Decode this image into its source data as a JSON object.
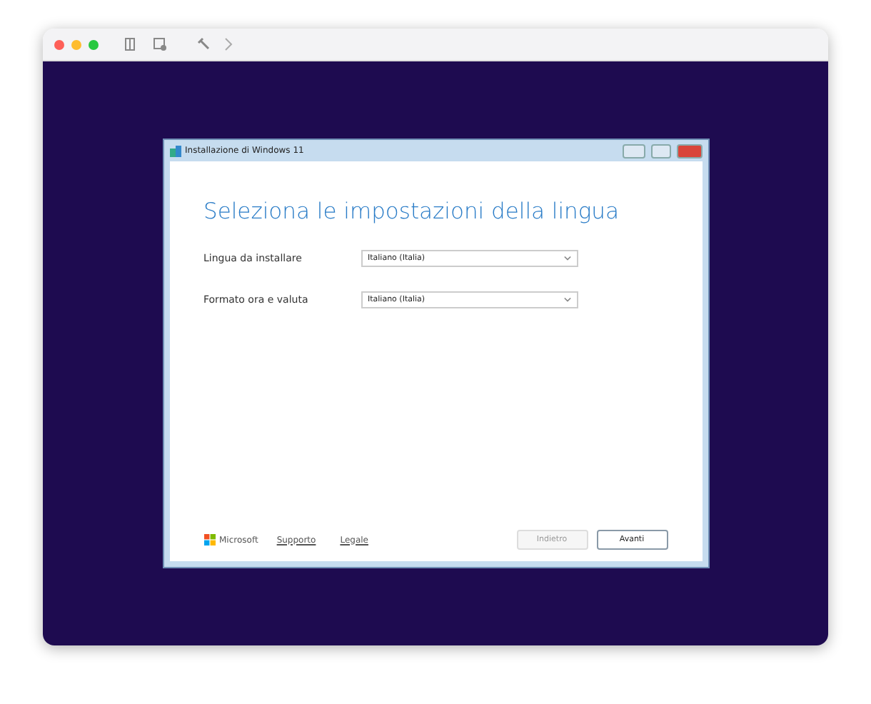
{
  "dialog": {
    "title": "Installazione di Windows 11",
    "heading": "Seleziona le impostazioni della lingua",
    "fields": [
      {
        "label": "Lingua da installare",
        "value": "Italiano (Italia)"
      },
      {
        "label": "Formato ora e valuta",
        "value": "Italiano (Italia)"
      }
    ],
    "brand": "Microsoft",
    "links": [
      "Supporto",
      "Legale"
    ],
    "buttons": [
      {
        "label": "Indietro",
        "disabled": true
      },
      {
        "label": "Avanti",
        "disabled": false
      }
    ]
  }
}
